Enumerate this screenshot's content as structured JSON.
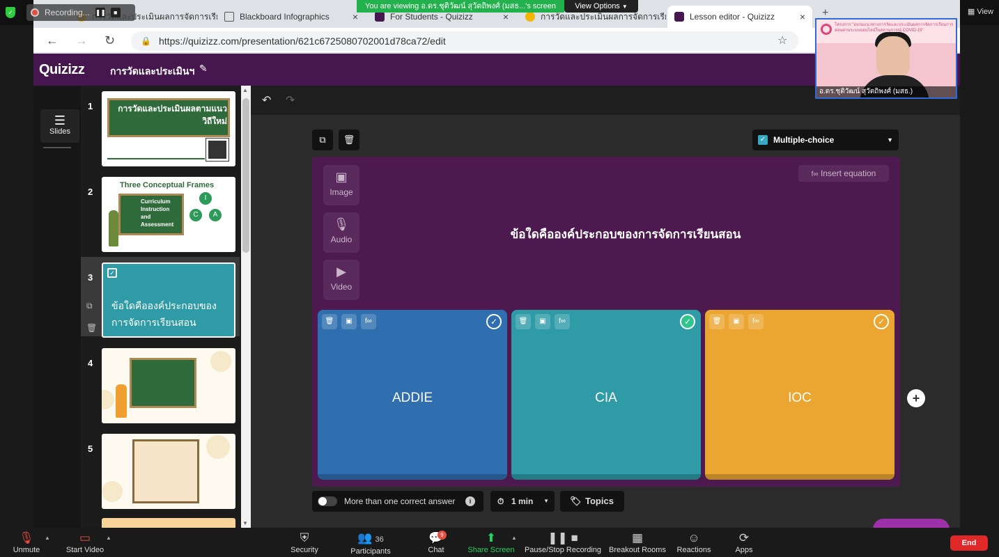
{
  "zoom": {
    "recording_label": "Recording...",
    "pause_icon": "pause-icon",
    "stop_icon": "stop-icon",
    "viewing_banner": "You are viewing อ.ดร.ชุติวัฒน์ สุวัตถิพงศ์ (มสธ...'s screen",
    "view_options": "View Options",
    "view_label": "View",
    "bottom_bar": {
      "unmute": "Unmute",
      "start_video": "Start Video",
      "security": "Security",
      "participants": "Participants",
      "participants_count": "36",
      "chat": "Chat",
      "chat_badge": "9",
      "share_screen": "Share Screen",
      "pause_stop_recording": "Pause/Stop Recording",
      "breakout_rooms": "Breakout Rooms",
      "reactions": "Reactions",
      "apps": "Apps",
      "end": "End"
    },
    "video": {
      "name": "อ.ดร.ชุติวัฒน์ สุวัตถิพงศ์ (มสธ.)",
      "banner": "โครงการ \"อบรมแนวทางการวัดและประเมินผลการจัดการเรียนการสอนผ่านระบบออนไลน์ในสถานการณ์ COVID-19\""
    }
  },
  "browser": {
    "tabs": [
      {
        "label": "การวัดและประเมินผลการจัดการเรีย...",
        "icon": "google-doc-icon"
      },
      {
        "label": "Blackboard Infographics",
        "icon": "document-icon"
      },
      {
        "label": "For Students - Quizizz",
        "icon": "quizizz-icon"
      },
      {
        "label": "การวัดและประเมินผลการจัดการเรีย...",
        "icon": "bulb-icon"
      },
      {
        "label": "Lesson editor - Quizizz",
        "icon": "quizizz-icon"
      }
    ],
    "url": "https://quizizz.com/presentation/621c6725080702001d78ca72/edit"
  },
  "app": {
    "logo": "Quizizz",
    "title": "การวัดและประเมินฯ",
    "slides_tab": "Slides",
    "slides": [
      {
        "number": "1",
        "text": "การวัดและประเมินผลตามแนววิถีใหม่"
      },
      {
        "number": "2",
        "text": "Three Conceptual Frames",
        "lines": [
          "Curriculum",
          "Instruction",
          "and",
          "Assessment"
        ],
        "badges": [
          "I",
          "C",
          "A"
        ]
      },
      {
        "number": "3",
        "text": "ข้อใดคือองค์ประกอบของการจัดการเรียนสอน"
      },
      {
        "number": "4",
        "text": ""
      },
      {
        "number": "5",
        "text": ""
      }
    ],
    "question_type": "Multiple-choice",
    "media": {
      "image": "Image",
      "audio": "Audio",
      "video": "Video"
    },
    "insert_equation": "Insert equation",
    "question_text": "ข้อใดคือองค์ประกอบของการจัดการเรียนสอน",
    "answers": [
      {
        "text": "ADDIE",
        "color": "#2f6fb0",
        "correct": false
      },
      {
        "text": "CIA",
        "color": "#2e9ba6",
        "correct": true
      },
      {
        "text": "IOC",
        "color": "#eba632",
        "correct": false
      }
    ],
    "more_than_one": "More than one correct answer",
    "time": "1 min",
    "topics": "Topics"
  }
}
